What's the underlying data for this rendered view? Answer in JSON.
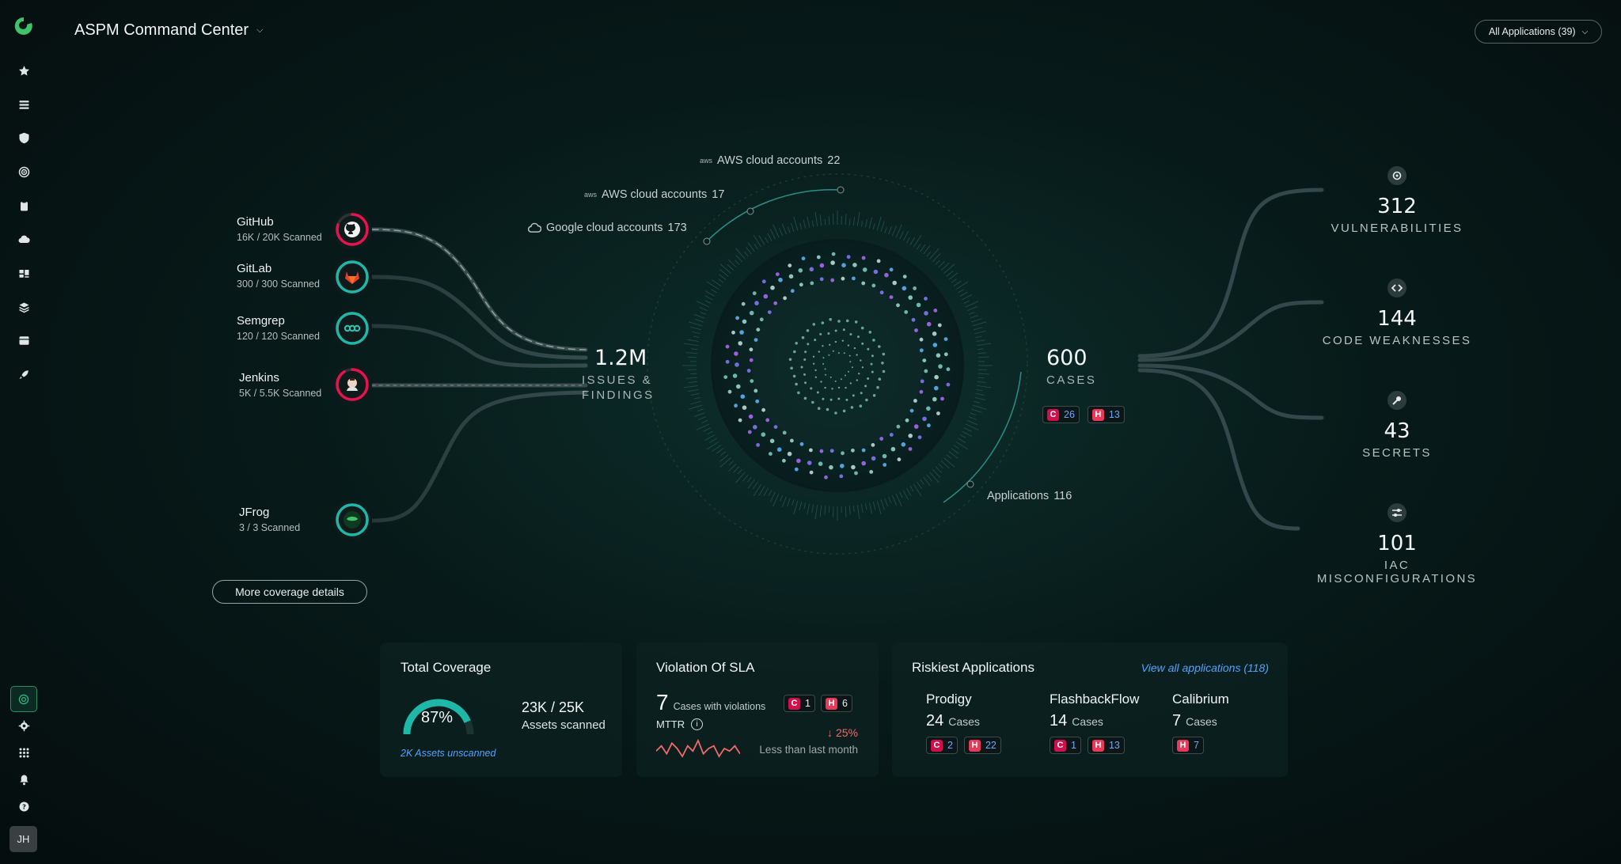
{
  "header": {
    "title": "ASPM Command Center",
    "app_filter": "All Applications (39)"
  },
  "sidebar": {
    "icons": [
      "star-icon",
      "layers-list-icon",
      "shield-icon",
      "target-icon",
      "clipboard-icon",
      "cloud-icon",
      "dashboard-icon",
      "stack-icon",
      "archive-icon",
      "rocket-icon"
    ],
    "bottom_icons": [
      "radar-icon",
      "gear-icon",
      "apps-grid-icon",
      "bell-icon",
      "help-icon"
    ],
    "avatar_initials": "JH"
  },
  "sources": [
    {
      "name": "GitHub",
      "scanned": "16K / 20K Scanned",
      "icon": "github-icon",
      "ring_color": "#e8124f",
      "fraction": 0.8
    },
    {
      "name": "GitLab",
      "scanned": "300 / 300 Scanned",
      "icon": "gitlab-icon",
      "ring_color": "#1fb8a8",
      "fraction": 1.0
    },
    {
      "name": "Semgrep",
      "scanned": "120 / 120 Scanned",
      "icon": "semgrep-icon",
      "ring_color": "#1fb8a8",
      "fraction": 1.0
    },
    {
      "name": "Jenkins",
      "scanned": "5K / 5.5K Scanned",
      "icon": "jenkins-icon",
      "ring_color": "#e8124f",
      "fraction": 0.91
    },
    {
      "name": "JFrog",
      "scanned": "3 / 3 Scanned",
      "icon": "jfrog-icon",
      "ring_color": "#1fb8a8",
      "fraction": 1.0
    }
  ],
  "more_coverage": "More coverage details",
  "clouds": [
    {
      "label": "AWS cloud accounts",
      "count": "22",
      "icon": "aws-icon"
    },
    {
      "label": "AWS cloud accounts",
      "count": "17",
      "icon": "aws-icon"
    },
    {
      "label": "Google cloud accounts",
      "count": "173",
      "icon": "gcp-cloud-icon"
    }
  ],
  "applications": {
    "label": "Applications",
    "count": "116"
  },
  "issues": {
    "value": "1.2M",
    "label_1": "ISSUES &",
    "label_2": "FINDINGS"
  },
  "cases": {
    "value": "600",
    "label": "CASES",
    "critical": "26",
    "high": "13",
    "critical_letter": "C",
    "high_letter": "H"
  },
  "metrics": [
    {
      "value": "312",
      "label": "VULNERABILITIES",
      "icon": "crosshair-icon"
    },
    {
      "value": "144",
      "label": "CODE WEAKNESSES",
      "icon": "code-icon"
    },
    {
      "value": "43",
      "label": "SECRETS",
      "icon": "key-icon"
    },
    {
      "value": "101",
      "label": "IAC MISCONFIGURATIONS",
      "icon": "sliders-icon"
    }
  ],
  "total_coverage": {
    "title": "Total Coverage",
    "percent_label": "87%",
    "percent": 87,
    "assets": "23K / 25K",
    "assets_label": "Assets scanned",
    "unscanned": "2K Assets unscanned"
  },
  "sla": {
    "title": "Violation Of SLA",
    "count": "7",
    "count_label": "Cases with violations",
    "critical": "1",
    "high": "6",
    "mttr": "MTTR",
    "change": "25%",
    "change_label": "Less than last month",
    "trend": [
      4,
      6,
      3,
      7,
      5,
      2,
      6,
      4,
      8,
      3,
      5,
      6,
      2,
      5,
      4,
      6,
      3
    ]
  },
  "riskiest": {
    "title": "Riskiest Applications",
    "view_all": "View all applications (118)",
    "cases_word": "Cases",
    "apps": [
      {
        "name": "Prodigy",
        "cases": "24",
        "critical": "2",
        "high": "22"
      },
      {
        "name": "FlashbackFlow",
        "cases": "14",
        "critical": "1",
        "high": "13"
      },
      {
        "name": "Calibrium",
        "cases": "7",
        "critical": null,
        "high": "7"
      }
    ]
  },
  "colors": {
    "accent": "#1fb8a8",
    "critical": "#d0104c",
    "high": "#e8395a",
    "link": "#4fa3ff",
    "trend_down": "#f06a6a"
  }
}
